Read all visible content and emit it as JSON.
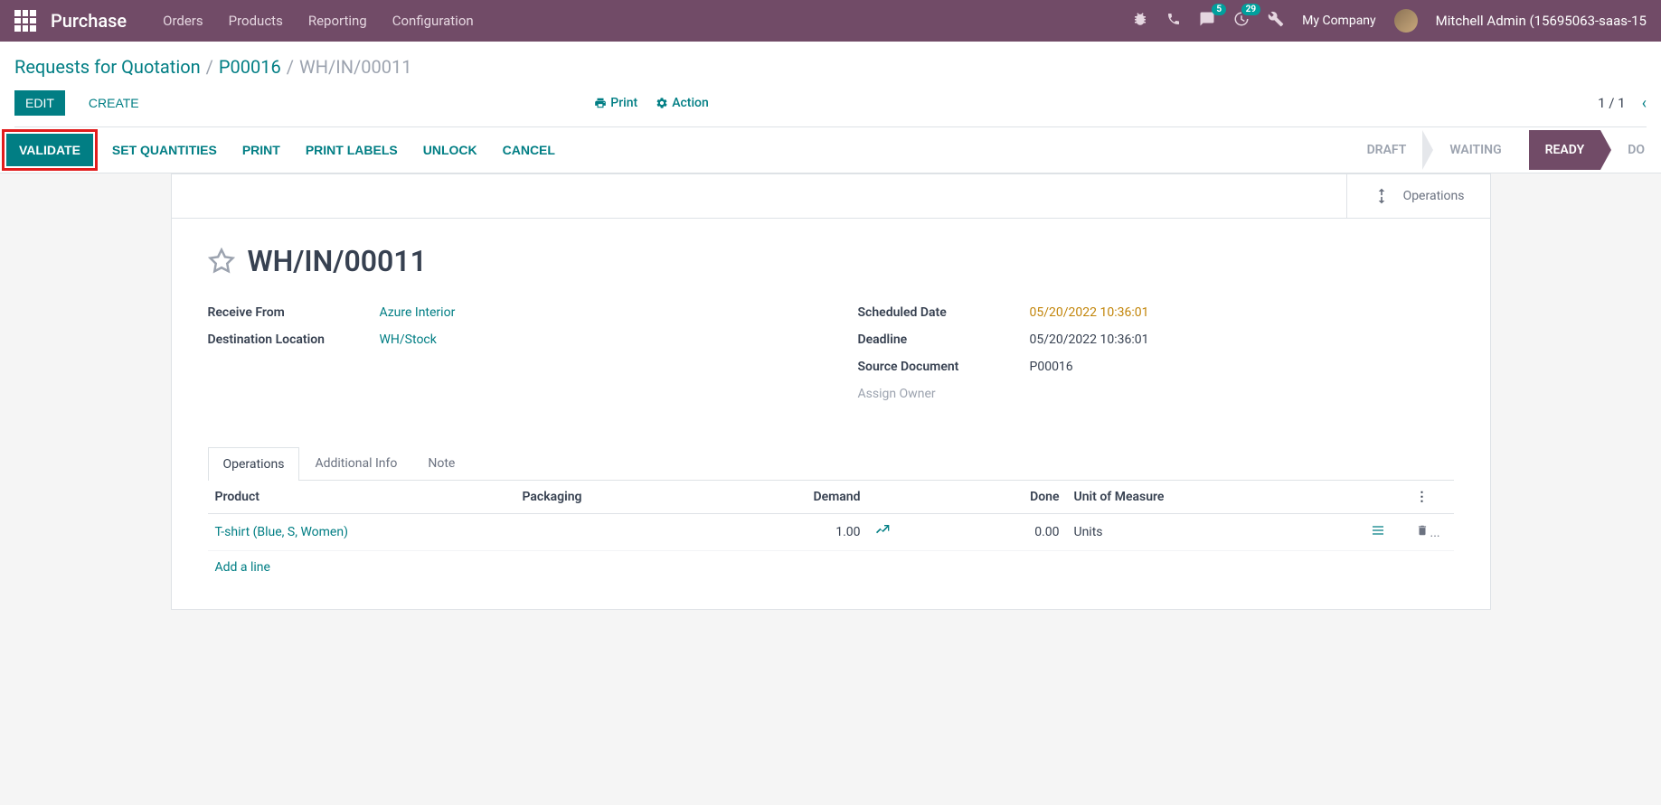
{
  "topbar": {
    "app_title": "Purchase",
    "menu": [
      "Orders",
      "Products",
      "Reporting",
      "Configuration"
    ],
    "msg_badge": "5",
    "activity_badge": "29",
    "company": "My Company",
    "user": "Mitchell Admin (15695063-saas-15"
  },
  "breadcrumbs": {
    "root": "Requests for Quotation",
    "parent": "P00016",
    "current": "WH/IN/00011"
  },
  "controls": {
    "edit": "EDIT",
    "create": "CREATE",
    "print": "Print",
    "action": "Action",
    "pager": "1 / 1"
  },
  "actions": {
    "validate": "VALIDATE",
    "set_quantities": "SET QUANTITIES",
    "print": "PRINT",
    "print_labels": "PRINT LABELS",
    "unlock": "UNLOCK",
    "cancel": "CANCEL"
  },
  "status": {
    "draft": "DRAFT",
    "waiting": "WAITING",
    "ready": "READY",
    "done": "DO"
  },
  "stat": {
    "operations": "Operations"
  },
  "record": {
    "title": "WH/IN/00011",
    "receive_from_label": "Receive From",
    "receive_from": "Azure Interior",
    "dest_label": "Destination Location",
    "dest": "WH/Stock",
    "sched_label": "Scheduled Date",
    "sched": "05/20/2022 10:36:01",
    "deadline_label": "Deadline",
    "deadline": "05/20/2022 10:36:01",
    "source_label": "Source Document",
    "source": "P00016",
    "assign_owner": "Assign Owner"
  },
  "tabs": {
    "operations": "Operations",
    "additional": "Additional Info",
    "note": "Note"
  },
  "table": {
    "headers": {
      "product": "Product",
      "packaging": "Packaging",
      "demand": "Demand",
      "done": "Done",
      "uom": "Unit of Measure"
    },
    "row": {
      "product": "T-shirt (Blue, S, Women)",
      "packaging": "",
      "demand": "1.00",
      "done": "0.00",
      "uom": "Units"
    },
    "add_line": "Add a line"
  }
}
